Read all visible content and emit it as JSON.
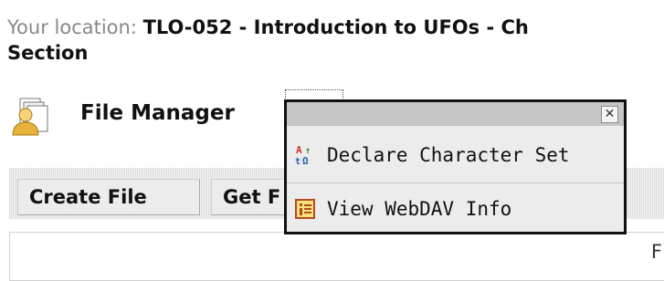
{
  "location": {
    "prefix": "Your location: ",
    "course": "TLO-052 - Introduction to UFOs - Ch",
    "section": "Section"
  },
  "file_manager": {
    "title": "File Manager"
  },
  "toolbar": {
    "create_file_label": "Create File",
    "get_label": "Get F"
  },
  "content": {
    "partial_text": "F"
  },
  "popup": {
    "close_symbol": "✕",
    "items": [
      {
        "label": "Declare Character Set",
        "icon": "charset-icon"
      },
      {
        "label": "View WebDAV Info",
        "icon": "webdav-info-icon"
      }
    ]
  },
  "colors": {
    "popup_border": "#111111",
    "popup_bg": "#ececec",
    "location_prefix": "#888888"
  }
}
